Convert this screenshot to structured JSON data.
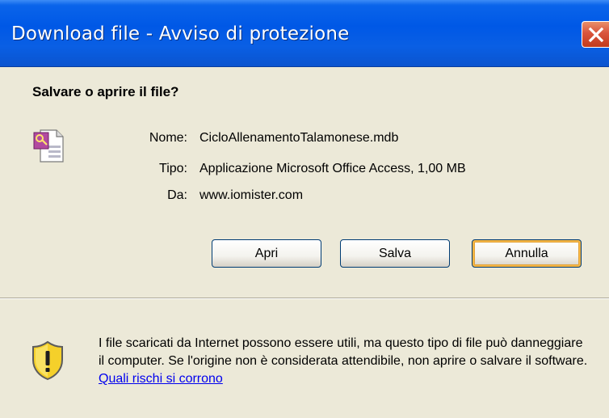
{
  "window": {
    "title": "Download file - Avviso di protezione"
  },
  "dialog": {
    "heading": "Salvare o aprire il file?",
    "file": {
      "name_label": "Nome:",
      "name_value": "CicloAllenamentoTalamonese.mdb",
      "type_label": "Tipo:",
      "type_value": "Applicazione Microsoft Office Access, 1,00 MB",
      "from_label": "Da:",
      "from_value": "www.iomister.com",
      "icon": "access-file-icon"
    },
    "buttons": {
      "open": "Apri",
      "save": "Salva",
      "cancel": "Annulla"
    }
  },
  "warning": {
    "icon": "shield-warning-icon",
    "text": "I file scaricati da Internet possono essere utili, ma questo tipo di file può danneggiare il computer. Se l'origine non è considerata attendibile, non aprire o salvare il software.",
    "link": "Quali rischi si corrono"
  },
  "colors": {
    "titlebar": "#0058e6",
    "close": "#d9543c",
    "dialog_bg": "#ece9d8",
    "default_button_highlight": "#f5b543",
    "link": "#0000ee"
  }
}
